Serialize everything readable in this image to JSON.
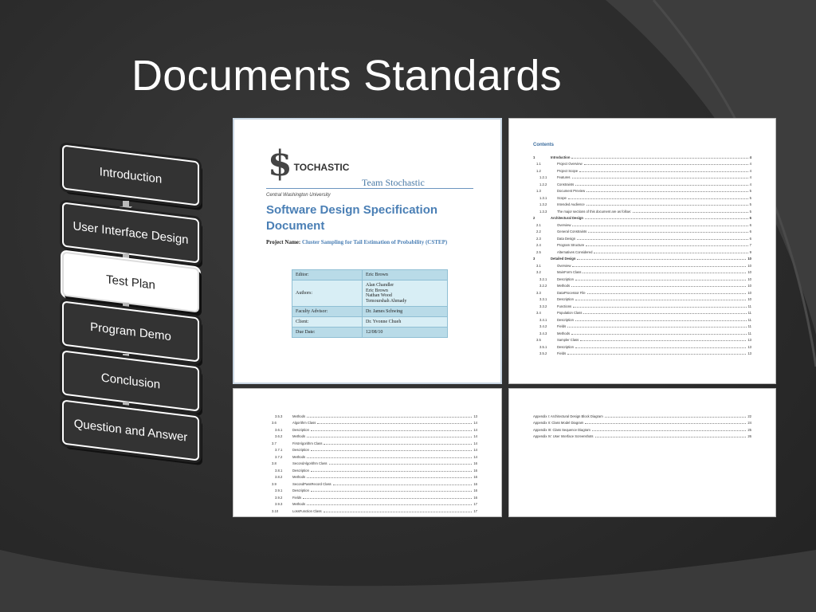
{
  "slide_title": "Documents Standards",
  "flow_steps": [
    {
      "label": "Introduction",
      "active": false
    },
    {
      "label": "User Interface Design",
      "active": false
    },
    {
      "label": "Test Plan",
      "active": true
    },
    {
      "label": "Program Demo",
      "active": false
    },
    {
      "label": "Conclusion",
      "active": false
    },
    {
      "label": "Question and Answer",
      "active": false
    }
  ],
  "cover": {
    "logo_text": "TOCHASTIC",
    "team": "Team Stochastic",
    "university": "Central Washington University",
    "doc_title": "Software Design Specification Document",
    "project_label": "Project Name:",
    "project_name": "Cluster Sampling for Tail Estimation of Probability (CSTEP)",
    "table": [
      {
        "key": "Editor:",
        "value": "Eric Brown"
      },
      {
        "key": "Authors:",
        "value": "Alan Chandler\nEric Brown\nNathan Wood\nTemourshah Ahmady"
      },
      {
        "key": "Faculty Advisor:",
        "value": "Dr. James Schwing"
      },
      {
        "key": "Client:",
        "value": "Dr. Yvonne Chueh"
      },
      {
        "key": "Due Date:",
        "value": "12/08/10"
      }
    ]
  },
  "contents_heading": "Contents",
  "toc_page1": [
    {
      "num": "1",
      "title": "Introduction",
      "page": "4",
      "level": 0
    },
    {
      "num": "1.1",
      "title": "Project Overview",
      "page": "4",
      "level": 1
    },
    {
      "num": "1.2",
      "title": "Project Scope",
      "page": "4",
      "level": 1
    },
    {
      "num": "1.2.1",
      "title": "Features",
      "page": "4",
      "level": 2
    },
    {
      "num": "1.2.2",
      "title": "Constraints",
      "page": "4",
      "level": 2
    },
    {
      "num": "1.3",
      "title": "Document Preview",
      "page": "5",
      "level": 1
    },
    {
      "num": "1.3.1",
      "title": "Scope",
      "page": "5",
      "level": 2
    },
    {
      "num": "1.3.2",
      "title": "Intended Audience",
      "page": "5",
      "level": 2
    },
    {
      "num": "1.3.3",
      "title": "The major sections of this document are as follow:",
      "page": "5",
      "level": 2
    },
    {
      "num": "2",
      "title": "Architectural Design",
      "page": "6",
      "level": 0
    },
    {
      "num": "2.1",
      "title": "Overview",
      "page": "6",
      "level": 1
    },
    {
      "num": "2.2",
      "title": "General Constraints",
      "page": "6",
      "level": 1
    },
    {
      "num": "2.3",
      "title": "Data Design",
      "page": "6",
      "level": 1
    },
    {
      "num": "2.4",
      "title": "Program Structure",
      "page": "7",
      "level": 1
    },
    {
      "num": "2.5",
      "title": "Alternatives Considered",
      "page": "9",
      "level": 1
    },
    {
      "num": "3",
      "title": "Detailed Design",
      "page": "10",
      "level": 0
    },
    {
      "num": "3.1",
      "title": "Overview",
      "page": "10",
      "level": 1
    },
    {
      "num": "3.2",
      "title": "MainForm Class",
      "page": "10",
      "level": 1
    },
    {
      "num": "3.2.1",
      "title": "Description",
      "page": "10",
      "level": 2
    },
    {
      "num": "3.2.2",
      "title": "Methods",
      "page": "10",
      "level": 2
    },
    {
      "num": "3.3",
      "title": "DataProcessor File",
      "page": "10",
      "level": 1
    },
    {
      "num": "3.3.1",
      "title": "Description",
      "page": "10",
      "level": 2
    },
    {
      "num": "3.3.2",
      "title": "Functions",
      "page": "11",
      "level": 2
    },
    {
      "num": "3.4",
      "title": "Population Class",
      "page": "11",
      "level": 1
    },
    {
      "num": "3.4.1",
      "title": "Description",
      "page": "11",
      "level": 2
    },
    {
      "num": "3.4.2",
      "title": "Fields",
      "page": "11",
      "level": 2
    },
    {
      "num": "3.4.3",
      "title": "Methods",
      "page": "11",
      "level": 2
    },
    {
      "num": "3.5",
      "title": "Sampler Class",
      "page": "13",
      "level": 1
    },
    {
      "num": "3.5.1",
      "title": "Description",
      "page": "13",
      "level": 2
    },
    {
      "num": "3.5.2",
      "title": "Fields",
      "page": "13",
      "level": 2
    }
  ],
  "toc_page2": [
    {
      "num": "3.5.3",
      "title": "Methods",
      "page": "13",
      "level": 2
    },
    {
      "num": "3.6",
      "title": "Algorithm Class",
      "page": "14",
      "level": 1
    },
    {
      "num": "3.6.1",
      "title": "Description",
      "page": "14",
      "level": 2
    },
    {
      "num": "3.6.2",
      "title": "Methods",
      "page": "14",
      "level": 2
    },
    {
      "num": "3.7",
      "title": "FirstAlgorithm Class",
      "page": "14",
      "level": 1
    },
    {
      "num": "3.7.1",
      "title": "Description",
      "page": "14",
      "level": 2
    },
    {
      "num": "3.7.2",
      "title": "Methods",
      "page": "14",
      "level": 2
    },
    {
      "num": "3.8",
      "title": "SecondAlgorithm Class",
      "page": "16",
      "level": 1
    },
    {
      "num": "3.8.1",
      "title": "Description",
      "page": "16",
      "level": 2
    },
    {
      "num": "3.8.2",
      "title": "Methods",
      "page": "16",
      "level": 2
    },
    {
      "num": "3.9",
      "title": "SecondPassRecord Class",
      "page": "16",
      "level": 1
    },
    {
      "num": "3.9.1",
      "title": "Description",
      "page": "16",
      "level": 2
    },
    {
      "num": "3.9.2",
      "title": "Fields",
      "page": "16",
      "level": 2
    },
    {
      "num": "3.9.3",
      "title": "Methods",
      "page": "17",
      "level": 2
    },
    {
      "num": "3.10",
      "title": "LossFunction Class",
      "page": "17",
      "level": 1
    }
  ],
  "toc_appendix": [
    {
      "num": "",
      "title": "Appendix I: Architectural Design Block Diagram",
      "page": "22",
      "level": 0
    },
    {
      "num": "",
      "title": "Appendix II: Class Model Diagram",
      "page": "24",
      "level": 0
    },
    {
      "num": "",
      "title": "Appendix III: Class Sequence Diagram",
      "page": "25",
      "level": 0
    },
    {
      "num": "",
      "title": "Appendix IV: User Interface Screenshots",
      "page": "26",
      "level": 0
    }
  ],
  "colors": {
    "active_step": "#ffffff",
    "inactive_step": "#333333",
    "heading_blue": "#4a7fb5"
  }
}
